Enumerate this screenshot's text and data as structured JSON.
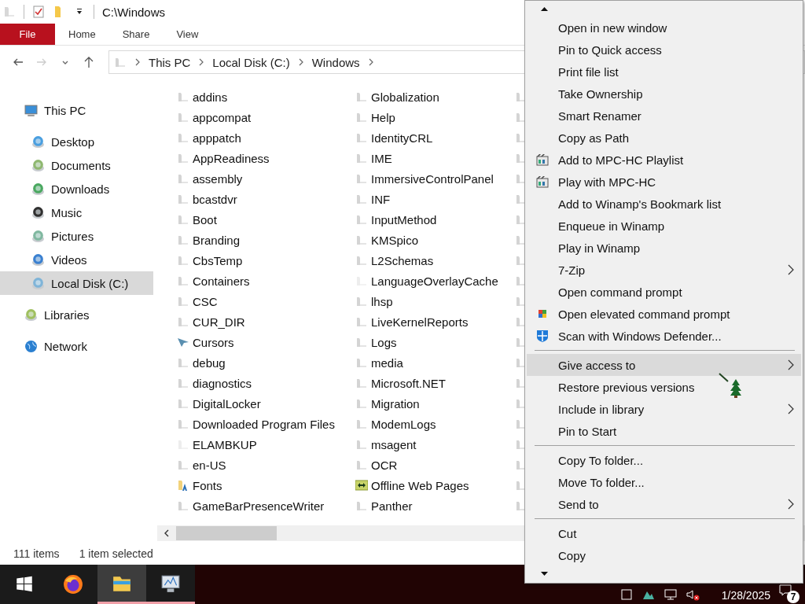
{
  "window": {
    "title": "C:\\Windows"
  },
  "ribbon_tabs": [
    {
      "label": "File",
      "kind": "file"
    },
    {
      "label": "Home",
      "kind": "tab"
    },
    {
      "label": "Share",
      "kind": "tab"
    },
    {
      "label": "View",
      "kind": "tab"
    }
  ],
  "address_bar": {
    "breadcrumbs": [
      "This PC",
      "Local Disk (C:)",
      "Windows"
    ]
  },
  "sidebar": {
    "items": [
      {
        "label": "This PC",
        "kind": "computer",
        "selected": false,
        "children": [
          {
            "label": "Desktop",
            "kind": "desktop",
            "selected": false
          },
          {
            "label": "Documents",
            "kind": "documents",
            "selected": false
          },
          {
            "label": "Downloads",
            "kind": "downloads",
            "selected": false
          },
          {
            "label": "Music",
            "kind": "music",
            "selected": false
          },
          {
            "label": "Pictures",
            "kind": "pictures",
            "selected": false
          },
          {
            "label": "Videos",
            "kind": "videos",
            "selected": false
          },
          {
            "label": "Local Disk (C:)",
            "kind": "drive",
            "selected": true
          }
        ]
      },
      {
        "label": "Libraries",
        "kind": "libraries",
        "selected": false
      },
      {
        "label": "Network",
        "kind": "network",
        "selected": false
      }
    ]
  },
  "files": {
    "columns": [
      [
        {
          "name": "addins",
          "kind": "folder"
        },
        {
          "name": "appcompat",
          "kind": "folder"
        },
        {
          "name": "apppatch",
          "kind": "folder"
        },
        {
          "name": "AppReadiness",
          "kind": "folder"
        },
        {
          "name": "assembly",
          "kind": "folder"
        },
        {
          "name": "bcastdvr",
          "kind": "folder"
        },
        {
          "name": "Boot",
          "kind": "folder"
        },
        {
          "name": "Branding",
          "kind": "folder"
        },
        {
          "name": "CbsTemp",
          "kind": "folder"
        },
        {
          "name": "Containers",
          "kind": "folder"
        },
        {
          "name": "CSC",
          "kind": "folder"
        },
        {
          "name": "CUR_DIR",
          "kind": "folder"
        },
        {
          "name": "Cursors",
          "kind": "cursor"
        },
        {
          "name": "debug",
          "kind": "folder"
        },
        {
          "name": "diagnostics",
          "kind": "folder"
        },
        {
          "name": "DigitalLocker",
          "kind": "folder"
        },
        {
          "name": "Downloaded Program Files",
          "kind": "folder"
        },
        {
          "name": "ELAMBKUP",
          "kind": "faded"
        },
        {
          "name": "en-US",
          "kind": "folder"
        },
        {
          "name": "Fonts",
          "kind": "fonts"
        },
        {
          "name": "GameBarPresenceWriter",
          "kind": "folder"
        }
      ],
      [
        {
          "name": "Globalization",
          "kind": "folder"
        },
        {
          "name": "Help",
          "kind": "folder"
        },
        {
          "name": "IdentityCRL",
          "kind": "folder"
        },
        {
          "name": "IME",
          "kind": "folder"
        },
        {
          "name": "ImmersiveControlPanel",
          "kind": "folder"
        },
        {
          "name": "INF",
          "kind": "folder"
        },
        {
          "name": "InputMethod",
          "kind": "folder"
        },
        {
          "name": "KMSpico",
          "kind": "folder"
        },
        {
          "name": "L2Schemas",
          "kind": "folder"
        },
        {
          "name": "LanguageOverlayCache",
          "kind": "faded"
        },
        {
          "name": "lhsp",
          "kind": "folder"
        },
        {
          "name": "LiveKernelReports",
          "kind": "folder"
        },
        {
          "name": "Logs",
          "kind": "folder"
        },
        {
          "name": "media",
          "kind": "folder"
        },
        {
          "name": "Microsoft.NET",
          "kind": "folder"
        },
        {
          "name": "Migration",
          "kind": "folder"
        },
        {
          "name": "ModemLogs",
          "kind": "folder"
        },
        {
          "name": "msagent",
          "kind": "folder"
        },
        {
          "name": "OCR",
          "kind": "folder"
        },
        {
          "name": "Offline Web Pages",
          "kind": "web"
        },
        {
          "name": "Panther",
          "kind": "folder"
        }
      ]
    ]
  },
  "status_bar": {
    "count": "111 items",
    "selection": "1 item selected"
  },
  "context_menu": {
    "items": [
      {
        "kind": "item",
        "label": "Open in new window"
      },
      {
        "kind": "item",
        "label": "Pin to Quick access"
      },
      {
        "kind": "item",
        "label": "Print file list"
      },
      {
        "kind": "item",
        "label": "Take Ownership"
      },
      {
        "kind": "item",
        "label": "Smart Renamer"
      },
      {
        "kind": "item",
        "label": "Copy as Path"
      },
      {
        "kind": "item",
        "label": "Add to MPC-HC Playlist"
      },
      {
        "kind": "item",
        "label": "Play with MPC-HC"
      },
      {
        "kind": "item",
        "label": "Add to Winamp's Bookmark list"
      },
      {
        "kind": "item",
        "label": "Enqueue in Winamp"
      },
      {
        "kind": "item",
        "label": "Play in Winamp"
      },
      {
        "kind": "item",
        "label": "7-Zip",
        "submenu": true
      },
      {
        "kind": "item",
        "label": "Open command prompt"
      },
      {
        "kind": "item",
        "label": "Open elevated command prompt"
      },
      {
        "kind": "item",
        "label": "Scan with Windows Defender..."
      },
      {
        "kind": "separator"
      },
      {
        "kind": "item",
        "label": "Give access to",
        "submenu": true,
        "highlighted": true
      },
      {
        "kind": "item",
        "label": "Restore previous versions"
      },
      {
        "kind": "item",
        "label": "Include in library",
        "submenu": true
      },
      {
        "kind": "item",
        "label": "Pin to Start"
      },
      {
        "kind": "separator"
      },
      {
        "kind": "item",
        "label": "Copy To folder..."
      },
      {
        "kind": "item",
        "label": "Move To folder..."
      },
      {
        "kind": "item",
        "label": "Send to",
        "submenu": true
      },
      {
        "kind": "separator"
      },
      {
        "kind": "item",
        "label": "Cut"
      },
      {
        "kind": "item",
        "label": "Copy"
      }
    ]
  },
  "taskbar": {
    "apps": [
      {
        "kind": "firefox",
        "active": false,
        "running": false
      },
      {
        "kind": "explorer",
        "active": true,
        "running": true
      },
      {
        "kind": "monitor",
        "active": false,
        "running": true
      }
    ],
    "date": "1/28/2025",
    "notifications": "7"
  }
}
